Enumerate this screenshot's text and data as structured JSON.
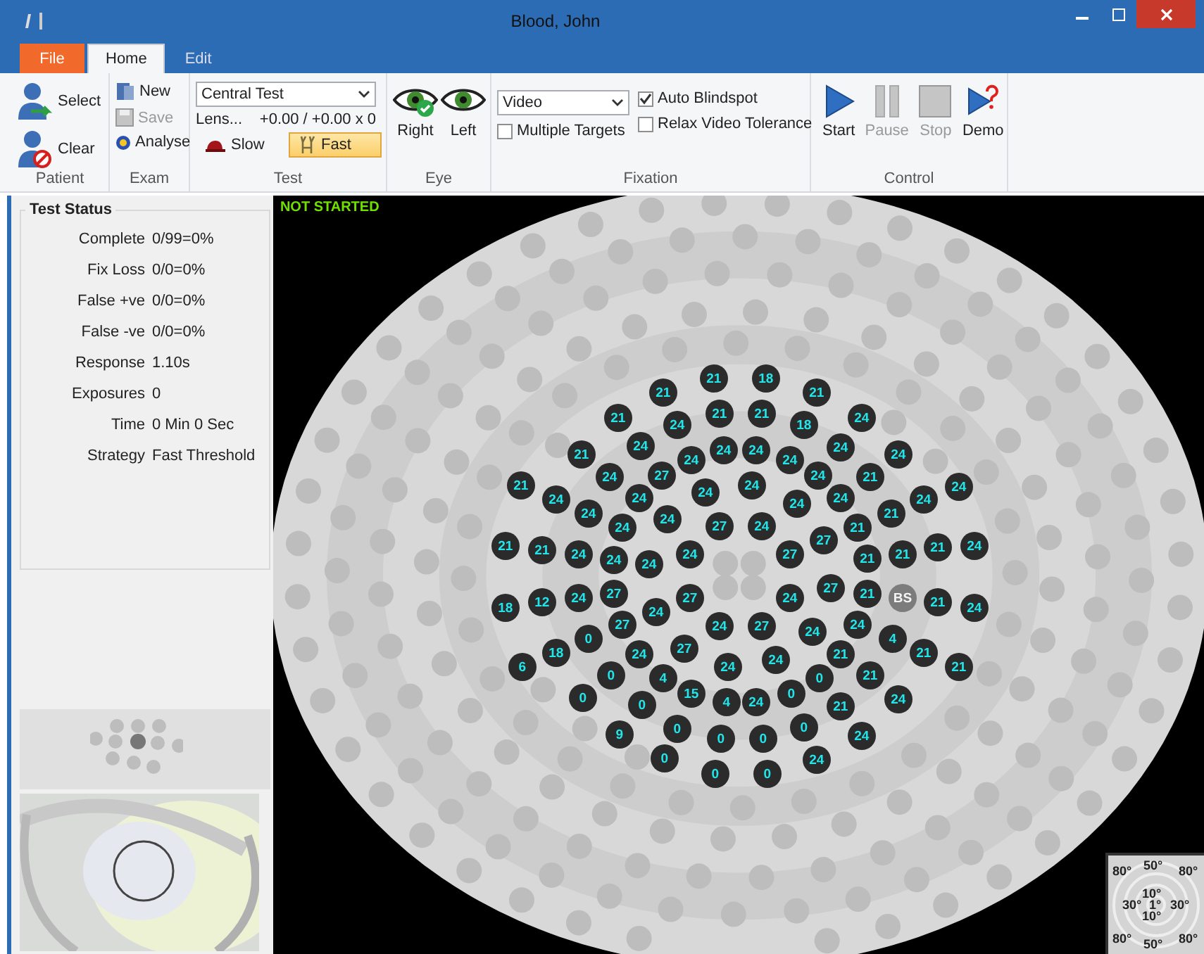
{
  "window": {
    "title": "Blood, John"
  },
  "ribbon_tabs": [
    {
      "label": "File",
      "kind": "menu"
    },
    {
      "label": "Home",
      "kind": "tab",
      "selected": true
    },
    {
      "label": "Edit",
      "kind": "tab",
      "selected": false
    }
  ],
  "patient": {
    "label": "Patient",
    "buttons": [
      {
        "label": "Select",
        "kind": "select"
      },
      {
        "label": "Clear",
        "kind": "clear"
      }
    ]
  },
  "exam": {
    "label": "Exam",
    "buttons": [
      {
        "label": "New",
        "kind": "new",
        "disabled": false
      },
      {
        "label": "Save",
        "kind": "save",
        "disabled": true
      },
      {
        "label": "Analyse",
        "kind": "analyse",
        "disabled": false
      }
    ]
  },
  "test": {
    "label": "Test",
    "dropdown": "Central Test",
    "lens_button": "Lens...",
    "lens_value": "+0.00 / +0.00 x 0",
    "speeds": [
      {
        "label": "Slow",
        "kind": "slow",
        "selected": false
      },
      {
        "label": "Fast",
        "kind": "fast",
        "selected": true
      }
    ]
  },
  "eye": {
    "label": "Eye",
    "eyes": [
      {
        "label": "Right",
        "selected": true
      },
      {
        "label": "Left",
        "selected": false
      }
    ]
  },
  "fixation": {
    "label": "Fixation",
    "dropdown": "Video",
    "checkboxes": [
      {
        "label": "Auto Blindspot",
        "checked": true
      },
      {
        "label": "Multiple Targets",
        "checked": false
      },
      {
        "label": "Relax Video Tolerance",
        "checked": false
      }
    ]
  },
  "control": {
    "label": "Control",
    "buttons": [
      {
        "label": "Start",
        "kind": "start",
        "disabled": false
      },
      {
        "label": "Pause",
        "kind": "pause",
        "disabled": true
      },
      {
        "label": "Stop",
        "kind": "stop",
        "disabled": true
      },
      {
        "label": "Demo",
        "kind": "demo",
        "disabled": false
      }
    ]
  },
  "test_status": {
    "title": "Test Status",
    "rows": [
      {
        "label": "Complete",
        "value": "0/99=0%"
      },
      {
        "label": "Fix Loss",
        "value": "0/0=0%"
      },
      {
        "label": "False +ve",
        "value": "0/0=0%"
      },
      {
        "label": "False -ve",
        "value": "0/0=0%"
      },
      {
        "label": "Response",
        "value": "1.10s"
      },
      {
        "label": "Exposures",
        "value": "0"
      },
      {
        "label": "Time",
        "value": "0 Min 0 Sec"
      },
      {
        "label": "Strategy",
        "value": "Fast Threshold"
      }
    ]
  },
  "field": {
    "status": "NOT STARTED",
    "points": [
      {
        "value": "21",
        "kind": "point"
      },
      {
        "value": "18",
        "kind": "point"
      },
      {
        "value": "21",
        "kind": "point"
      },
      {
        "value": "21",
        "kind": "point"
      },
      {
        "value": "21",
        "kind": "point"
      },
      {
        "value": "24",
        "kind": "point"
      },
      {
        "value": "21",
        "kind": "point"
      },
      {
        "value": "21",
        "kind": "point"
      },
      {
        "value": "18",
        "kind": "point"
      },
      {
        "value": "24",
        "kind": "point"
      },
      {
        "value": "21",
        "kind": "point"
      },
      {
        "value": "24",
        "kind": "point"
      },
      {
        "value": "24",
        "kind": "point"
      },
      {
        "value": "24",
        "kind": "point"
      },
      {
        "value": "24",
        "kind": "point"
      },
      {
        "value": "24",
        "kind": "point"
      },
      {
        "value": "24",
        "kind": "point"
      },
      {
        "value": "24",
        "kind": "point"
      },
      {
        "value": "21",
        "kind": "point"
      },
      {
        "value": "24",
        "kind": "point"
      },
      {
        "value": "27",
        "kind": "point"
      },
      {
        "value": "24",
        "kind": "point"
      },
      {
        "value": "21",
        "kind": "point"
      },
      {
        "value": "24",
        "kind": "point"
      },
      {
        "value": "24",
        "kind": "point"
      },
      {
        "value": "24",
        "kind": "point"
      },
      {
        "value": "24",
        "kind": "point"
      },
      {
        "value": "24",
        "kind": "point"
      },
      {
        "value": "24",
        "kind": "point"
      },
      {
        "value": "24",
        "kind": "point"
      },
      {
        "value": "24",
        "kind": "point"
      },
      {
        "value": "21",
        "kind": "point"
      },
      {
        "value": "24",
        "kind": "point"
      },
      {
        "value": "24",
        "kind": "point"
      },
      {
        "value": "24",
        "kind": "point"
      },
      {
        "value": "27",
        "kind": "point"
      },
      {
        "value": "24",
        "kind": "point"
      },
      {
        "value": "27",
        "kind": "point"
      },
      {
        "value": "21",
        "kind": "point"
      },
      {
        "value": "21",
        "kind": "point"
      },
      {
        "value": "21",
        "kind": "point"
      },
      {
        "value": "24",
        "kind": "point"
      },
      {
        "value": "24",
        "kind": "point"
      },
      {
        "value": "24",
        "kind": "point"
      },
      {
        "value": "24",
        "kind": "point"
      },
      {
        "value": "27",
        "kind": "point"
      },
      {
        "value": "21",
        "kind": "point"
      },
      {
        "value": "21",
        "kind": "point"
      },
      {
        "value": "21",
        "kind": "point"
      },
      {
        "value": "24",
        "kind": "point"
      },
      {
        "value": "18",
        "kind": "point"
      },
      {
        "value": "12",
        "kind": "point"
      },
      {
        "value": "24",
        "kind": "point"
      },
      {
        "value": "27",
        "kind": "point"
      },
      {
        "value": "24",
        "kind": "point"
      },
      {
        "value": "27",
        "kind": "point"
      },
      {
        "value": "24",
        "kind": "point"
      },
      {
        "value": "27",
        "kind": "point"
      },
      {
        "value": "21",
        "kind": "point"
      },
      {
        "value": "BS",
        "kind": "blindspot"
      },
      {
        "value": "21",
        "kind": "point"
      },
      {
        "value": "24",
        "kind": "point"
      },
      {
        "value": "27",
        "kind": "point"
      },
      {
        "value": "0",
        "kind": "point"
      },
      {
        "value": "24",
        "kind": "point"
      },
      {
        "value": "27",
        "kind": "point"
      },
      {
        "value": "24",
        "kind": "point"
      },
      {
        "value": "24",
        "kind": "point"
      },
      {
        "value": "4",
        "kind": "point"
      },
      {
        "value": "18",
        "kind": "point"
      },
      {
        "value": "6",
        "kind": "point"
      },
      {
        "value": "24",
        "kind": "point"
      },
      {
        "value": "27",
        "kind": "point"
      },
      {
        "value": "24",
        "kind": "point"
      },
      {
        "value": "24",
        "kind": "point"
      },
      {
        "value": "21",
        "kind": "point"
      },
      {
        "value": "21",
        "kind": "point"
      },
      {
        "value": "21",
        "kind": "point"
      },
      {
        "value": "0",
        "kind": "point"
      },
      {
        "value": "4",
        "kind": "point"
      },
      {
        "value": "0",
        "kind": "point"
      },
      {
        "value": "21",
        "kind": "point"
      },
      {
        "value": "0",
        "kind": "point"
      },
      {
        "value": "15",
        "kind": "point"
      },
      {
        "value": "4",
        "kind": "point"
      },
      {
        "value": "24",
        "kind": "point"
      },
      {
        "value": "0",
        "kind": "point"
      },
      {
        "value": "0",
        "kind": "point"
      },
      {
        "value": "21",
        "kind": "point"
      },
      {
        "value": "24",
        "kind": "point"
      },
      {
        "value": "9",
        "kind": "point"
      },
      {
        "value": "0",
        "kind": "point"
      },
      {
        "value": "0",
        "kind": "point"
      },
      {
        "value": "0",
        "kind": "point"
      },
      {
        "value": "0",
        "kind": "point"
      },
      {
        "value": "24",
        "kind": "point"
      },
      {
        "value": "0",
        "kind": "point"
      },
      {
        "value": "24",
        "kind": "point"
      },
      {
        "value": "0",
        "kind": "point"
      },
      {
        "value": "0",
        "kind": "point"
      }
    ],
    "legend": [
      "80°",
      "50°",
      "80°",
      "10°",
      "30°",
      "1°",
      "30°",
      "10°",
      "80°",
      "50°",
      "80°"
    ]
  }
}
